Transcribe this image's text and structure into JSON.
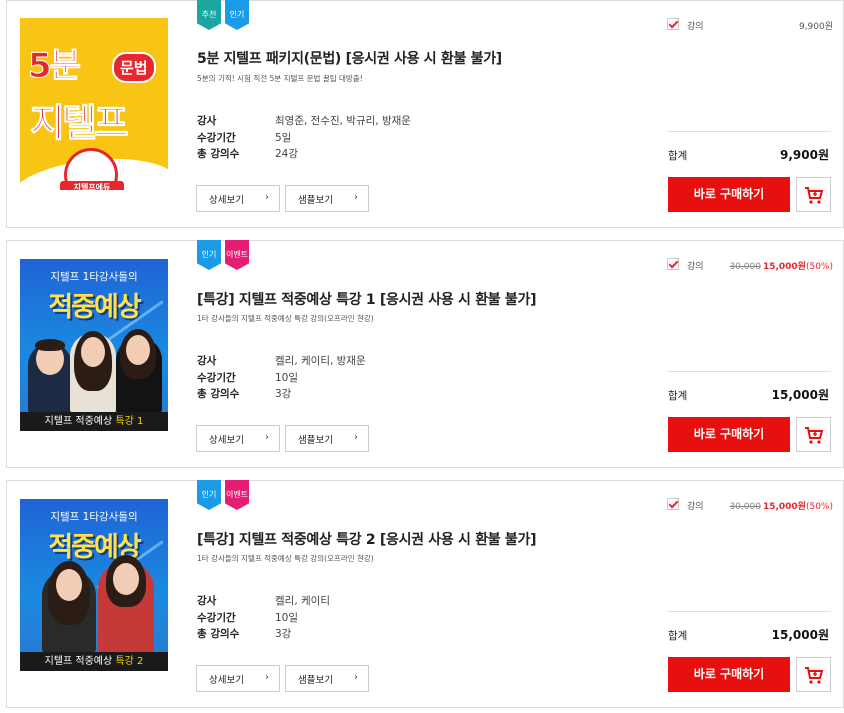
{
  "labels": {
    "detail_button": "상세보기",
    "sample_button": "샘플보기",
    "buy_button": "바로 구매하기",
    "total_label": "합계",
    "lecture_label": "강의",
    "info_teacher": "강사",
    "info_period": "수강기간",
    "info_count": "총 강의수"
  },
  "colors": {
    "accent_red": "#e8100f",
    "badge_teal": "#1ca6a0",
    "badge_blue": "#1b9be6",
    "badge_pink": "#e61d74"
  },
  "products": [
    {
      "badges": [
        "추천",
        "인기"
      ],
      "title": "5분 지텔프 패키지(문법) [응시권 사용 시 환불 불가]",
      "description": "5분의 기적! 시험 직전 5분 지텔프 문법 꿀팁 대방출!",
      "teacher": "최영준, 전수진, 박규리, 방재운",
      "period": "5일",
      "count": "24강",
      "price_original": "",
      "price": "9,900원",
      "discount": "",
      "total": "9,900원",
      "thumbnail": {
        "line1": "5분",
        "pill": "문법",
        "line2": "지텔프",
        "mascot": "지텔프에듀"
      }
    },
    {
      "badges": [
        "인기",
        "이벤트"
      ],
      "title": "[특강] 지텔프 적중예상 특강 1 [응시권 사용 시 환불 불가]",
      "description": "1타 강사들의 지텔프 적중예상 특강 강의(오프라인 현강)",
      "teacher": "켈리, 케이티, 방재운",
      "period": "10일",
      "count": "3강",
      "price_original": "30,000",
      "price": "15,000원",
      "discount": "(50%)",
      "total": "15,000원",
      "thumbnail": {
        "subhead": "지텔프 1타강사들의",
        "headline": "적중예상",
        "footer": "지텔프 적중예상",
        "footer_hl": "특강 1"
      }
    },
    {
      "badges": [
        "인기",
        "이벤트"
      ],
      "title": "[특강] 지텔프 적중예상 특강 2 [응시권 사용 시 환불 불가]",
      "description": "1타 강사들의 지텔프 적중예상 특강 강의(오프라인 현강)",
      "teacher": "켈리, 케이티",
      "period": "10일",
      "count": "3강",
      "price_original": "30,000",
      "price": "15,000원",
      "discount": "(50%)",
      "total": "15,000원",
      "thumbnail": {
        "subhead": "지텔프 1타강사들의",
        "headline": "적중예상",
        "footer": "지텔프 적중예상",
        "footer_hl": "특강 2"
      }
    }
  ]
}
